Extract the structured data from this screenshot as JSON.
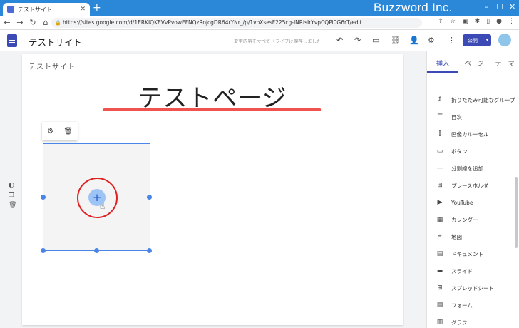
{
  "browser": {
    "tab_title": "テストサイト",
    "url": "https://sites.google.com/d/1ERKIQKEVvPvowEFNQzRojcgDR64rYNr_/p/1voXsesF225cg-INRisIrYvpCQPi0G6rT/edit",
    "watermark": "Buzzword Inc."
  },
  "sites": {
    "site_name": "テストサイト",
    "autosave_text": "変更内容をすべてドライブに保存しました",
    "publish_label": "公開"
  },
  "page": {
    "header_name": "テストサイト",
    "title": "テストページ"
  },
  "panel": {
    "tabs": [
      "挿入",
      "ページ",
      "テーマ"
    ],
    "items": [
      {
        "label": "折りたたみ可能なグループ",
        "icon": "collapsible-icon"
      },
      {
        "label": "目次",
        "icon": "toc-icon"
      },
      {
        "label": "画像カルーセル",
        "icon": "carousel-icon"
      },
      {
        "label": "ボタン",
        "icon": "button-icon"
      },
      {
        "label": "分割線を追加",
        "icon": "divider-icon"
      },
      {
        "label": "プレースホルダ",
        "icon": "placeholder-icon"
      },
      {
        "label": "YouTube",
        "icon": "youtube-icon"
      },
      {
        "label": "カレンダー",
        "icon": "calendar-icon"
      },
      {
        "label": "地図",
        "icon": "map-icon"
      },
      {
        "label": "ドキュメント",
        "icon": "document-icon"
      },
      {
        "label": "スライド",
        "icon": "slides-icon"
      },
      {
        "label": "スプレッドシート",
        "icon": "sheets-icon"
      },
      {
        "label": "フォーム",
        "icon": "forms-icon"
      },
      {
        "label": "グラフ",
        "icon": "chart-icon"
      }
    ]
  },
  "colors": {
    "accent": "#3c4ab5",
    "selection": "#4a86e8",
    "title_underline": "#ef5350",
    "highlight_circle": "#e02020"
  }
}
